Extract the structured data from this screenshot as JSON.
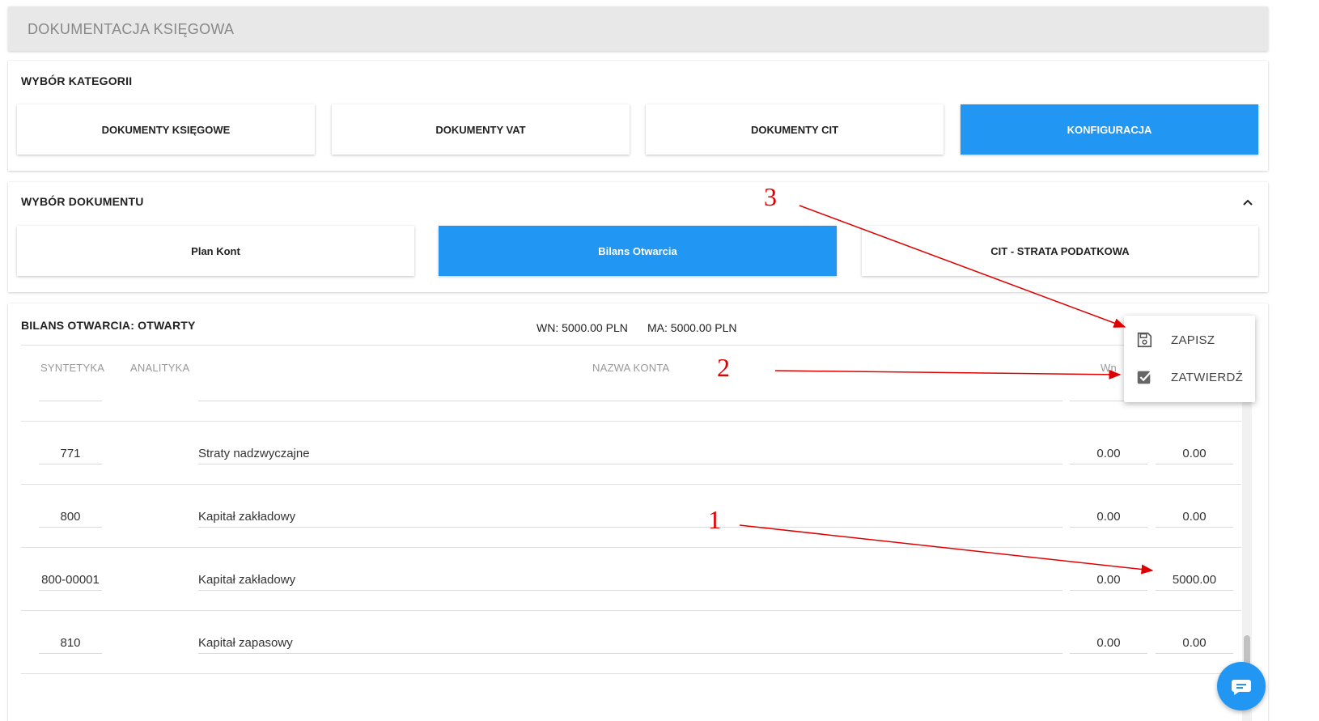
{
  "header": {
    "title": "DOKUMENTACJA KSIĘGOWA"
  },
  "categories": {
    "title": "WYBÓR KATEGORII",
    "tiles": [
      {
        "label": "DOKUMENTY KSIĘGOWE",
        "active": false
      },
      {
        "label": "DOKUMENTY VAT",
        "active": false
      },
      {
        "label": "DOKUMENTY CIT",
        "active": false
      },
      {
        "label": "KONFIGURACJA",
        "active": true
      }
    ]
  },
  "documents": {
    "title": "WYBÓR DOKUMENTU",
    "tiles": [
      {
        "label": "Plan Kont",
        "active": false
      },
      {
        "label": "Bilans Otwarcia",
        "active": true
      },
      {
        "label": "CIT - STRATA PODATKOWA",
        "active": false
      }
    ]
  },
  "balance": {
    "title": "BILANS OTWARCIA: OTWARTY",
    "wn_total": "WN: 5000.00 PLN",
    "ma_total": "MA: 5000.00 PLN",
    "columns": {
      "synthetic": "SYNTETYKA",
      "analytic": "ANALITYKA",
      "account_name": "NAZWA KONTA",
      "wn": "Wn"
    },
    "rows": [
      {
        "synthetic": "771",
        "name": "Straty nadzwyczajne",
        "wn": "0.00",
        "ma": "0.00"
      },
      {
        "synthetic": "800",
        "name": "Kapitał zakładowy",
        "wn": "0.00",
        "ma": "0.00"
      },
      {
        "synthetic": "800-00001",
        "name": "Kapitał zakładowy",
        "wn": "0.00",
        "ma": "5000.00"
      },
      {
        "synthetic": "810",
        "name": "Kapitał zapasowy",
        "wn": "0.00",
        "ma": "0.00"
      }
    ]
  },
  "menu": {
    "items": [
      {
        "label": "ZAPISZ",
        "icon": "save-icon"
      },
      {
        "label": "ZATWIERDŹ",
        "icon": "check-box-icon"
      }
    ]
  },
  "annotations": {
    "one": "1",
    "two": "2",
    "three": "3"
  },
  "colors": {
    "accent": "#2196f3",
    "annotation": "#e00000"
  }
}
